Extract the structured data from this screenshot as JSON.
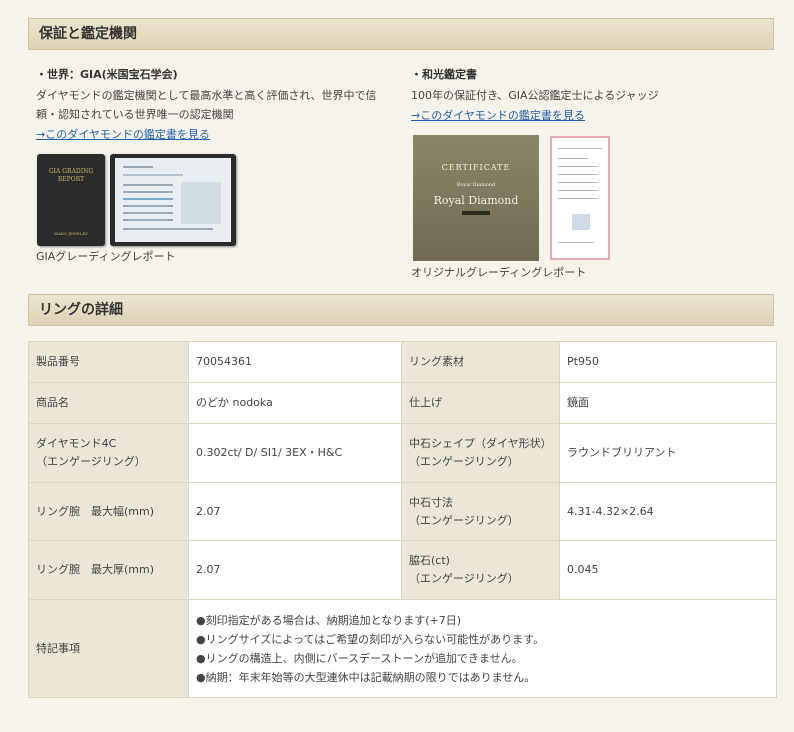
{
  "sections": {
    "guarantee_title": "保証と鑑定機関",
    "ring_title": "リングの詳細"
  },
  "gia": {
    "title": "・世界：GIA(米国宝石学会)",
    "desc_line1": "ダイヤモンドの鑑定機関として最高水準と高く評価され、世界中で信",
    "desc_line2": "頼・認知されている世界唯一の認定機関",
    "link": "→このダイヤモンドの鑑定書を見る",
    "caption": "GIAグレーディングレポート",
    "folder_text": "GIA GRADING REPORT",
    "folder_bottom": "WAKO JEWELRY"
  },
  "wako": {
    "title": "・和光鑑定書",
    "desc_line1": "100年の保証付き、GIA公認鑑定士によるジャッジ",
    "link": "→このダイヤモンドの鑑定書を見る",
    "caption": "オリジナルグレーディングレポート",
    "cert_word": "CERTIFICATE",
    "cert_sub": "Royal Diamond",
    "cert_name": "Royal Diamond"
  },
  "details": {
    "rows": [
      {
        "l1": "製品番号",
        "v1": "70054361",
        "l2": "リング素材",
        "v2": "Pt950"
      },
      {
        "l1": "商品名",
        "v1": "のどか nodoka",
        "l2": "仕上げ",
        "v2": "鏡面"
      },
      {
        "l1": "ダイヤモンド4C\n（エンゲージリング）",
        "v1": "0.302ct/ D/ SI1/ 3EX・H&C",
        "l2": "中石シェイプ（ダイヤ形状）\n（エンゲージリング）",
        "v2": "ラウンドブリリアント"
      },
      {
        "l1": "リング腕　最大幅(mm)",
        "v1": "2.07",
        "l2": "中石寸法\n（エンゲージリング）",
        "v2": "4.31-4.32×2.64"
      },
      {
        "l1": "リング腕　最大厚(mm)",
        "v1": "2.07",
        "l2": "脇石(ct)\n（エンゲージリング）",
        "v2": "0.045"
      }
    ],
    "notes_label": "特記事項",
    "notes": [
      "●刻印指定がある場合は、納期追加となります(+7日)",
      "●リングサイズによってはご希望の刻印が入らない可能性があります。",
      "●リングの構造上、内側にバースデーストーンが追加できません。",
      "●納期：年末年始等の大型連休中は記載納期の限りではありません。"
    ]
  }
}
